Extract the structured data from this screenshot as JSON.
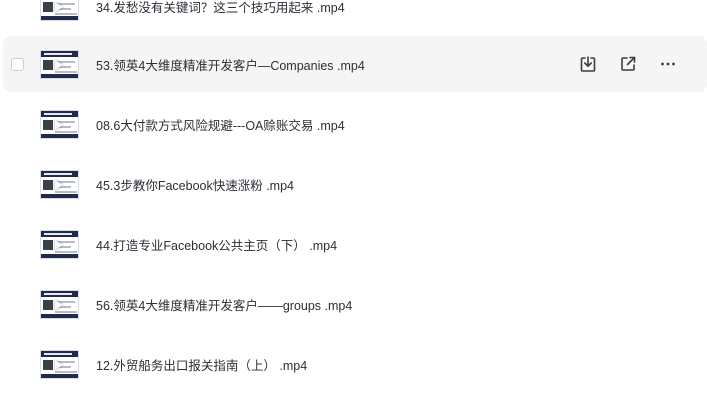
{
  "files": [
    {
      "name": "34.发愁没有关键词？这三个技巧用起来 .mp4",
      "hovered": false
    },
    {
      "name": "53.领英4大维度精准开发客户—Companies .mp4",
      "hovered": true
    },
    {
      "name": "08.6大付款方式风险规避---OA赊账交易 .mp4",
      "hovered": false
    },
    {
      "name": "45.3步教你Facebook快速涨粉 .mp4",
      "hovered": false
    },
    {
      "name": "44.打造专业Facebook公共主页（下） .mp4",
      "hovered": false
    },
    {
      "name": "56.领英4大维度精准开发客户——groups .mp4",
      "hovered": false
    },
    {
      "name": "12.外贸船务出口报关指南（上） .mp4",
      "hovered": false
    }
  ],
  "icons": {
    "thumbnail": "video-thumbnail-icon",
    "download": "download-icon",
    "share": "share-icon",
    "more": "more-icon"
  },
  "colors": {
    "hover_bg": "#f5f5f6",
    "text": "#2b2f36",
    "icon": "#3a3d44"
  }
}
